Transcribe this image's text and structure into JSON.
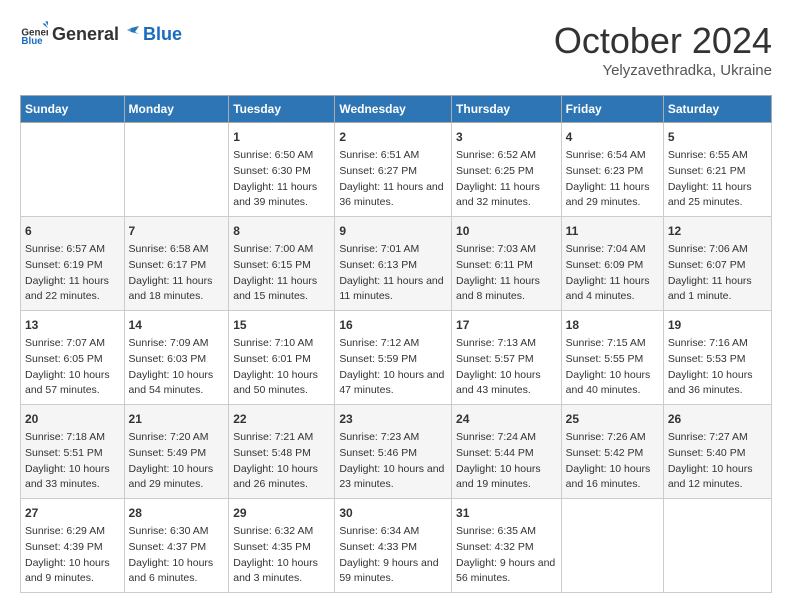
{
  "header": {
    "logo_general": "General",
    "logo_blue": "Blue",
    "month": "October 2024",
    "location": "Yelyzavethradka, Ukraine"
  },
  "days_of_week": [
    "Sunday",
    "Monday",
    "Tuesday",
    "Wednesday",
    "Thursday",
    "Friday",
    "Saturday"
  ],
  "weeks": [
    [
      {
        "day": "",
        "content": ""
      },
      {
        "day": "",
        "content": ""
      },
      {
        "day": "1",
        "content": "Sunrise: 6:50 AM\nSunset: 6:30 PM\nDaylight: 11 hours and 39 minutes."
      },
      {
        "day": "2",
        "content": "Sunrise: 6:51 AM\nSunset: 6:27 PM\nDaylight: 11 hours and 36 minutes."
      },
      {
        "day": "3",
        "content": "Sunrise: 6:52 AM\nSunset: 6:25 PM\nDaylight: 11 hours and 32 minutes."
      },
      {
        "day": "4",
        "content": "Sunrise: 6:54 AM\nSunset: 6:23 PM\nDaylight: 11 hours and 29 minutes."
      },
      {
        "day": "5",
        "content": "Sunrise: 6:55 AM\nSunset: 6:21 PM\nDaylight: 11 hours and 25 minutes."
      }
    ],
    [
      {
        "day": "6",
        "content": "Sunrise: 6:57 AM\nSunset: 6:19 PM\nDaylight: 11 hours and 22 minutes."
      },
      {
        "day": "7",
        "content": "Sunrise: 6:58 AM\nSunset: 6:17 PM\nDaylight: 11 hours and 18 minutes."
      },
      {
        "day": "8",
        "content": "Sunrise: 7:00 AM\nSunset: 6:15 PM\nDaylight: 11 hours and 15 minutes."
      },
      {
        "day": "9",
        "content": "Sunrise: 7:01 AM\nSunset: 6:13 PM\nDaylight: 11 hours and 11 minutes."
      },
      {
        "day": "10",
        "content": "Sunrise: 7:03 AM\nSunset: 6:11 PM\nDaylight: 11 hours and 8 minutes."
      },
      {
        "day": "11",
        "content": "Sunrise: 7:04 AM\nSunset: 6:09 PM\nDaylight: 11 hours and 4 minutes."
      },
      {
        "day": "12",
        "content": "Sunrise: 7:06 AM\nSunset: 6:07 PM\nDaylight: 11 hours and 1 minute."
      }
    ],
    [
      {
        "day": "13",
        "content": "Sunrise: 7:07 AM\nSunset: 6:05 PM\nDaylight: 10 hours and 57 minutes."
      },
      {
        "day": "14",
        "content": "Sunrise: 7:09 AM\nSunset: 6:03 PM\nDaylight: 10 hours and 54 minutes."
      },
      {
        "day": "15",
        "content": "Sunrise: 7:10 AM\nSunset: 6:01 PM\nDaylight: 10 hours and 50 minutes."
      },
      {
        "day": "16",
        "content": "Sunrise: 7:12 AM\nSunset: 5:59 PM\nDaylight: 10 hours and 47 minutes."
      },
      {
        "day": "17",
        "content": "Sunrise: 7:13 AM\nSunset: 5:57 PM\nDaylight: 10 hours and 43 minutes."
      },
      {
        "day": "18",
        "content": "Sunrise: 7:15 AM\nSunset: 5:55 PM\nDaylight: 10 hours and 40 minutes."
      },
      {
        "day": "19",
        "content": "Sunrise: 7:16 AM\nSunset: 5:53 PM\nDaylight: 10 hours and 36 minutes."
      }
    ],
    [
      {
        "day": "20",
        "content": "Sunrise: 7:18 AM\nSunset: 5:51 PM\nDaylight: 10 hours and 33 minutes."
      },
      {
        "day": "21",
        "content": "Sunrise: 7:20 AM\nSunset: 5:49 PM\nDaylight: 10 hours and 29 minutes."
      },
      {
        "day": "22",
        "content": "Sunrise: 7:21 AM\nSunset: 5:48 PM\nDaylight: 10 hours and 26 minutes."
      },
      {
        "day": "23",
        "content": "Sunrise: 7:23 AM\nSunset: 5:46 PM\nDaylight: 10 hours and 23 minutes."
      },
      {
        "day": "24",
        "content": "Sunrise: 7:24 AM\nSunset: 5:44 PM\nDaylight: 10 hours and 19 minutes."
      },
      {
        "day": "25",
        "content": "Sunrise: 7:26 AM\nSunset: 5:42 PM\nDaylight: 10 hours and 16 minutes."
      },
      {
        "day": "26",
        "content": "Sunrise: 7:27 AM\nSunset: 5:40 PM\nDaylight: 10 hours and 12 minutes."
      }
    ],
    [
      {
        "day": "27",
        "content": "Sunrise: 6:29 AM\nSunset: 4:39 PM\nDaylight: 10 hours and 9 minutes."
      },
      {
        "day": "28",
        "content": "Sunrise: 6:30 AM\nSunset: 4:37 PM\nDaylight: 10 hours and 6 minutes."
      },
      {
        "day": "29",
        "content": "Sunrise: 6:32 AM\nSunset: 4:35 PM\nDaylight: 10 hours and 3 minutes."
      },
      {
        "day": "30",
        "content": "Sunrise: 6:34 AM\nSunset: 4:33 PM\nDaylight: 9 hours and 59 minutes."
      },
      {
        "day": "31",
        "content": "Sunrise: 6:35 AM\nSunset: 4:32 PM\nDaylight: 9 hours and 56 minutes."
      },
      {
        "day": "",
        "content": ""
      },
      {
        "day": "",
        "content": ""
      }
    ]
  ]
}
